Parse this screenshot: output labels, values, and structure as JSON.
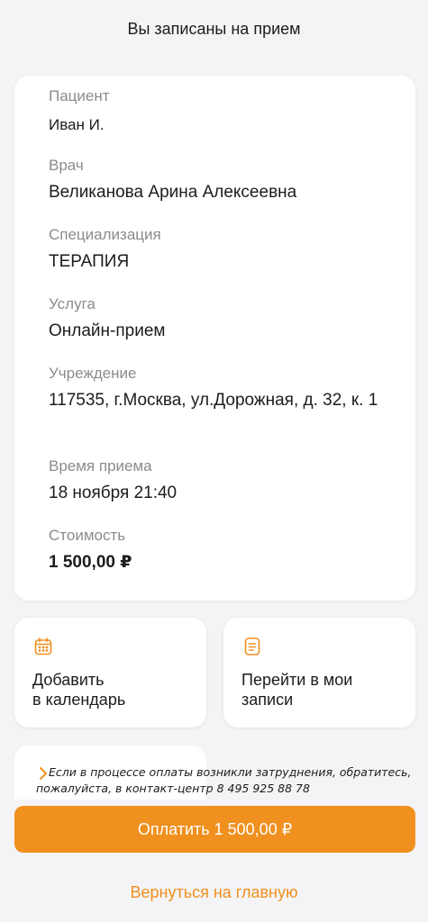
{
  "header": {
    "title": "Вы записаны на прием"
  },
  "appointment": {
    "patient": {
      "label": "Пациент",
      "value": "Иван И."
    },
    "doctor": {
      "label": "Врач",
      "value": "Великанова Арина Алексеевна"
    },
    "specialization": {
      "label": "Специализация",
      "value": "ТЕРАПИЯ"
    },
    "service": {
      "label": "Услуга",
      "value": "Онлайн-прием"
    },
    "clinic": {
      "label": "Учреждение",
      "value": "117535, г.Москва, ул.Дорожная, д. 32, к. 1"
    },
    "time": {
      "label": "Время приема",
      "value": "18 ноября 21:40"
    },
    "cost": {
      "label": "Стоимость",
      "value": "1 500,00 ₽"
    }
  },
  "actions": {
    "add_calendar": {
      "label": "Добавить\nв календарь",
      "icon": "calendar-icon"
    },
    "my_records": {
      "label": "Перейти в мои\nзаписи",
      "icon": "document-icon"
    }
  },
  "help": {
    "text": "Если в процессе оплаты возникли затруднения, обратитесь, пожалуйста, в контакт-центр 8 495 925 88 78",
    "icon": "chevron-right-icon"
  },
  "pay_button": {
    "label": "Оплатить 1 500,00 ₽"
  },
  "back_link": {
    "label": "Вернуться на главную"
  },
  "colors": {
    "accent": "#f0901e",
    "background": "#f4f4f6",
    "label_gray": "#8b8b90"
  }
}
